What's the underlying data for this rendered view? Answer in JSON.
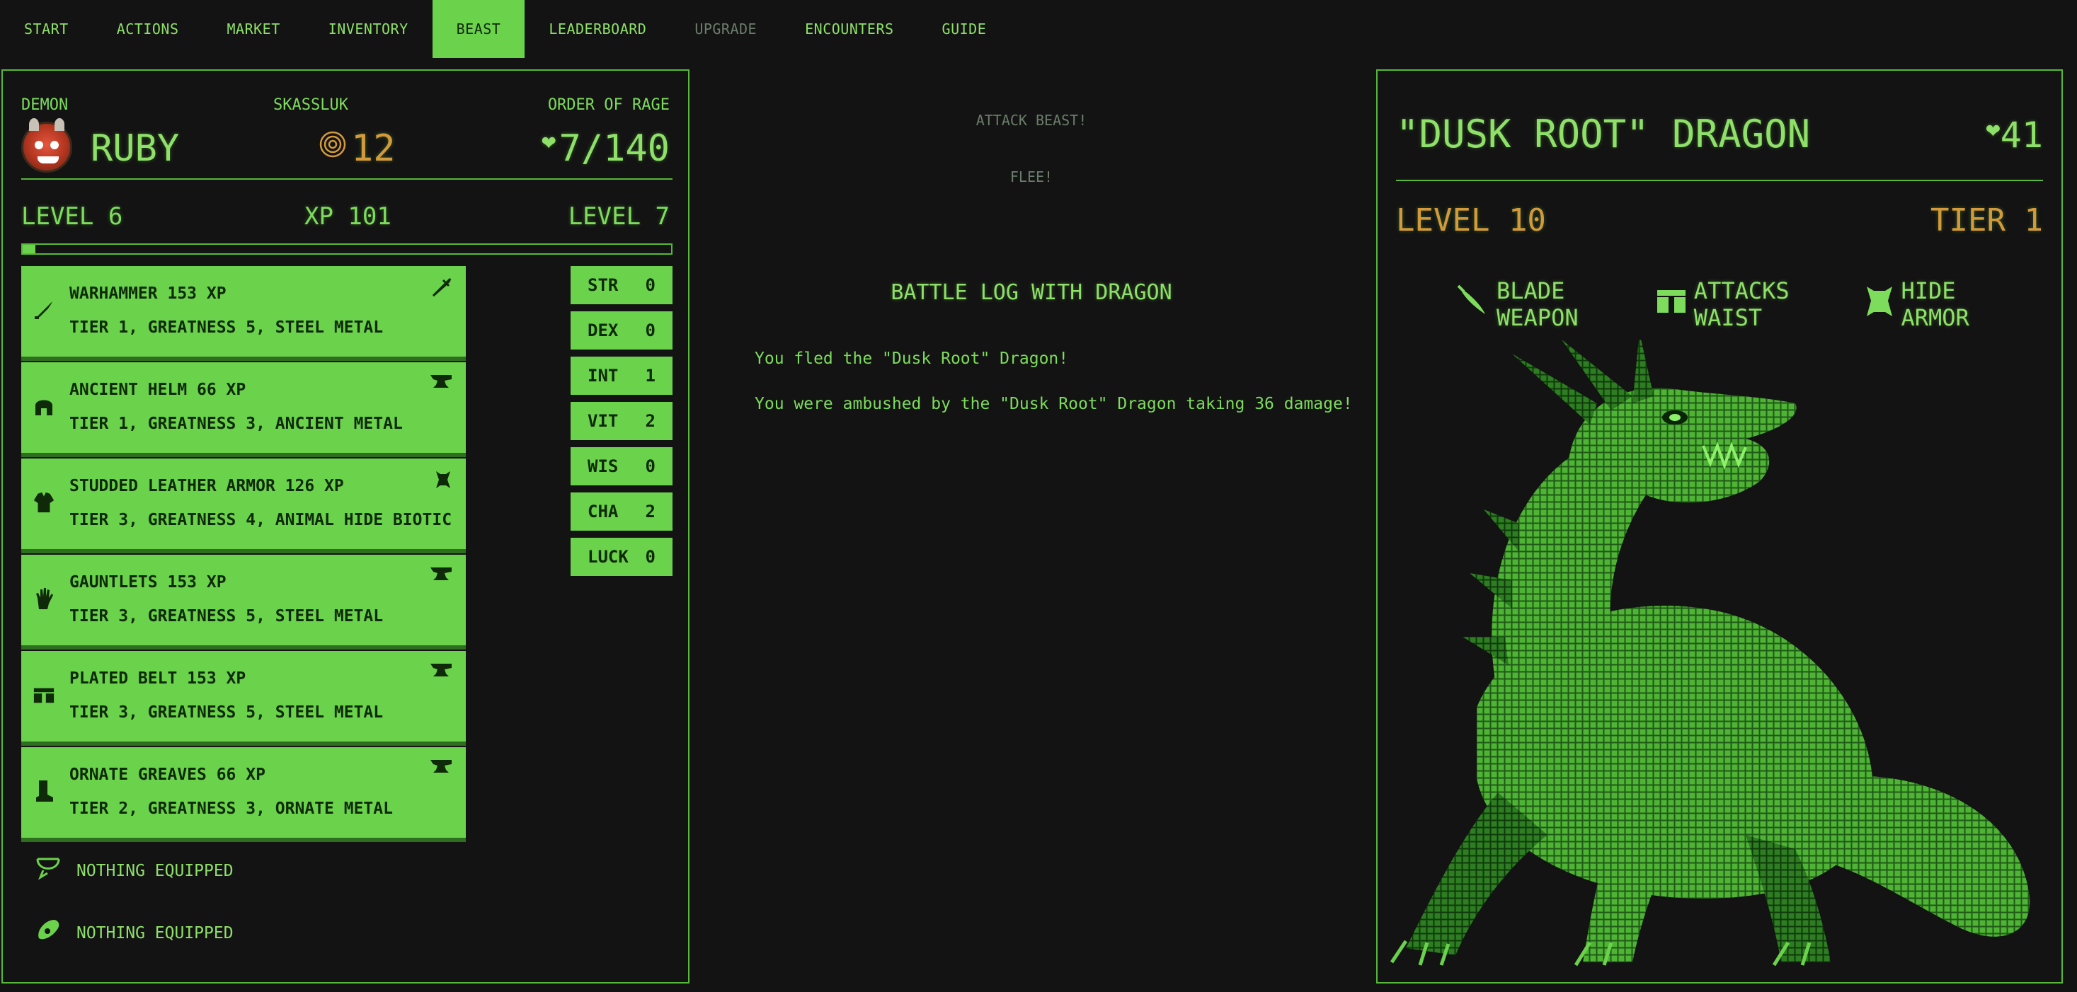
{
  "nav": {
    "items": [
      {
        "label": "START",
        "state": "normal"
      },
      {
        "label": "ACTIONS",
        "state": "normal"
      },
      {
        "label": "MARKET",
        "state": "normal"
      },
      {
        "label": "INVENTORY",
        "state": "normal"
      },
      {
        "label": "BEAST",
        "state": "active"
      },
      {
        "label": "LEADERBOARD",
        "state": "normal"
      },
      {
        "label": "UPGRADE",
        "state": "disabled"
      },
      {
        "label": "ENCOUNTERS",
        "state": "normal"
      },
      {
        "label": "GUIDE",
        "state": "normal"
      }
    ]
  },
  "adventurer": {
    "class": "DEMON",
    "name": "RUBY",
    "realm": "SKASSLUK",
    "gold": "12",
    "order": "ORDER OF RAGE",
    "health": "7/140",
    "level": "LEVEL 6",
    "xp": "XP 101",
    "next_level": "LEVEL 7",
    "xp_progress": 0.02
  },
  "gear": [
    {
      "icon": "weapon-icon",
      "title": "WARHAMMER 153 XP",
      "desc": "TIER 1, GREATNESS 5, STEEL METAL",
      "corner": "sword-upgrade-icon"
    },
    {
      "icon": "helm-icon",
      "title": "ANCIENT HELM 66 XP",
      "desc": "TIER 1, GREATNESS 3, ANCIENT METAL",
      "corner": "anvil-icon"
    },
    {
      "icon": "chest-icon",
      "title": "STUDDED LEATHER ARMOR 126 XP",
      "desc": "TIER 3, GREATNESS 4, ANIMAL HIDE BIOTIC",
      "corner": "hide-icon"
    },
    {
      "icon": "gloves-icon",
      "title": "GAUNTLETS 153 XP",
      "desc": "TIER 3, GREATNESS 5, STEEL METAL",
      "corner": "anvil-icon"
    },
    {
      "icon": "belt-icon",
      "title": "PLATED BELT 153 XP",
      "desc": "TIER 3, GREATNESS 5, STEEL METAL",
      "corner": "anvil-icon"
    },
    {
      "icon": "boots-icon",
      "title": "ORNATE GREAVES 66 XP",
      "desc": "TIER 2, GREATNESS 3, ORNATE METAL",
      "corner": "anvil-icon"
    }
  ],
  "empty_slots": [
    {
      "icon": "necklace-icon",
      "label": "NOTHING EQUIPPED"
    },
    {
      "icon": "ring-icon",
      "label": "NOTHING EQUIPPED"
    }
  ],
  "stats": [
    {
      "name": "STR",
      "value": "0"
    },
    {
      "name": "DEX",
      "value": "0"
    },
    {
      "name": "INT",
      "value": "1"
    },
    {
      "name": "VIT",
      "value": "2"
    },
    {
      "name": "WIS",
      "value": "0"
    },
    {
      "name": "CHA",
      "value": "2"
    },
    {
      "name": "LUCK",
      "value": "0"
    }
  ],
  "actions": {
    "attack": "ATTACK BEAST!",
    "flee": "FLEE!"
  },
  "battle_log": {
    "title": "BATTLE LOG WITH DRAGON",
    "lines": [
      "You fled the \"Dusk Root\" Dragon!",
      "You were ambushed by the \"Dusk Root\" Dragon taking 36 damage!"
    ]
  },
  "beast": {
    "name": "\"DUSK ROOT\" DRAGON",
    "health": "41",
    "level": "LEVEL 10",
    "tier": "TIER 1",
    "attributes": [
      {
        "icon": "blade-icon",
        "label": "BLADE WEAPON"
      },
      {
        "icon": "waist-icon",
        "label": "ATTACKS WAIST"
      },
      {
        "icon": "hide-armor-icon",
        "label": "HIDE ARMOR"
      }
    ]
  },
  "colors": {
    "background": "#131313",
    "accent": "#6bd24c",
    "text": "#7ddc5c",
    "gold": "#d49a3a",
    "disabled": "#6b7e6a"
  }
}
